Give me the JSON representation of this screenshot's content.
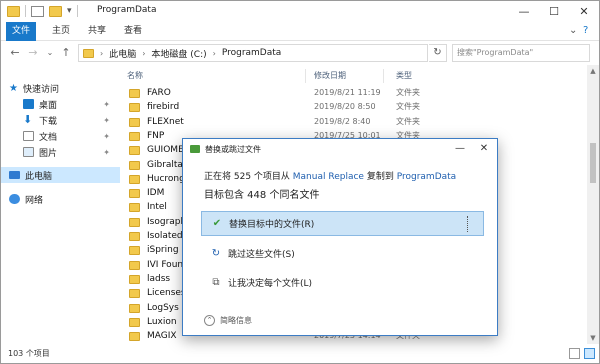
{
  "window": {
    "title": "ProgramData",
    "ribbon_tabs": [
      "文件",
      "主页",
      "共享",
      "查看"
    ]
  },
  "address": {
    "crumbs": [
      "此电脑",
      "本地磁盘 (C:)",
      "ProgramData"
    ],
    "search_placeholder": "搜索\"ProgramData\""
  },
  "nav": {
    "quick_access": "快速访问",
    "items": [
      "桌面",
      "下载",
      "文档",
      "图片"
    ],
    "this_pc": "此电脑",
    "network": "网络"
  },
  "columns": {
    "name": "名称",
    "date": "修改日期",
    "type": "类型"
  },
  "files": [
    {
      "name": "FARO",
      "date": "2019/8/21 11:19",
      "type": "文件夹"
    },
    {
      "name": "firebird",
      "date": "2019/8/20 8:50",
      "type": "文件夹"
    },
    {
      "name": "FLEXnet",
      "date": "2019/8/2 8:40",
      "type": "文件夹"
    },
    {
      "name": "FNP",
      "date": "2019/7/25 10:01",
      "type": "文件夹"
    },
    {
      "name": "GUIOME",
      "date": "",
      "type": ""
    },
    {
      "name": "Gibraltar",
      "date": "",
      "type": ""
    },
    {
      "name": "Hucrong",
      "date": "",
      "type": ""
    },
    {
      "name": "IDM",
      "date": "",
      "type": ""
    },
    {
      "name": "Intel",
      "date": "",
      "type": ""
    },
    {
      "name": "Isograph",
      "date": "",
      "type": ""
    },
    {
      "name": "Isolated Re",
      "date": "",
      "type": ""
    },
    {
      "name": "iSpring So",
      "date": "",
      "type": ""
    },
    {
      "name": "IVI Founde",
      "date": "",
      "type": ""
    },
    {
      "name": "ladss",
      "date": "",
      "type": ""
    },
    {
      "name": "Licenses",
      "date": "",
      "type": ""
    },
    {
      "name": "LogSys",
      "date": "",
      "type": ""
    },
    {
      "name": "Luxion",
      "date": "",
      "type": ""
    },
    {
      "name": "MAGIX",
      "date": "2019/7/23 14:14",
      "type": "文件夹"
    }
  ],
  "status": {
    "count": "103 个项目"
  },
  "dialog": {
    "title": "替换或跳过文件",
    "line1_prefix": "正在将 525 个项目从",
    "source": "Manual Replace",
    "line1_mid": "复制到",
    "dest": "ProgramData",
    "line2": "目标包含 448 个同名文件",
    "options": [
      {
        "icon": "✔",
        "label": "替换目标中的文件(R)"
      },
      {
        "icon": "↻",
        "label": "跳过这些文件(S)"
      },
      {
        "icon": "⧉",
        "label": "让我决定每个文件(L)"
      }
    ],
    "more": "简略信息"
  },
  "colors": {
    "accent": "#1979ca",
    "folder": "#f2c94c",
    "selection": "#cce8ff",
    "link": "#1f5faf",
    "check": "#3a9a3a"
  }
}
